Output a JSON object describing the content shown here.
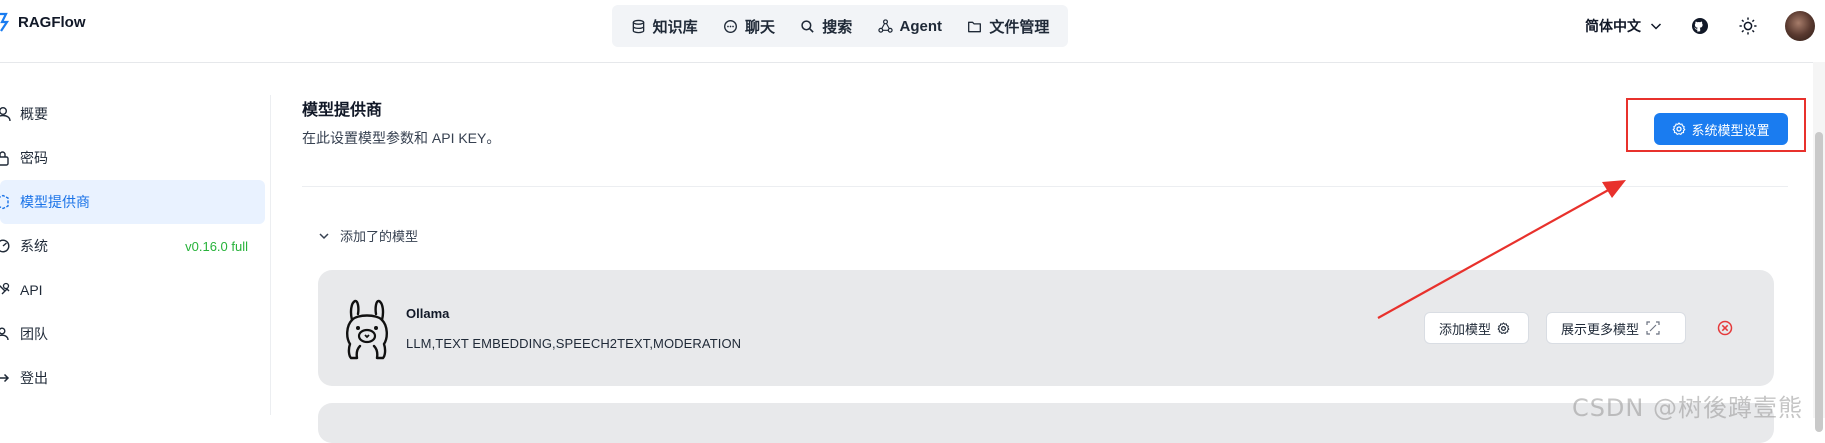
{
  "header": {
    "brand": "RAGFlow",
    "nav": [
      {
        "label": "知识库",
        "icon": "database-icon"
      },
      {
        "label": "聊天",
        "icon": "chat-bubble-icon"
      },
      {
        "label": "搜索",
        "icon": "search-icon"
      },
      {
        "label": "Agent",
        "icon": "agent-graph-icon"
      },
      {
        "label": "文件管理",
        "icon": "folder-icon"
      }
    ],
    "language": "简体中文",
    "tools": [
      "github-icon",
      "sun-icon",
      "avatar"
    ]
  },
  "sidebar": {
    "items": [
      {
        "label": "概要",
        "icon": "user-icon",
        "active": false
      },
      {
        "label": "密码",
        "icon": "lock-icon",
        "active": false
      },
      {
        "label": "模型提供商",
        "icon": "box-icon",
        "active": true
      },
      {
        "label": "系统",
        "icon": "gauge-icon",
        "active": false,
        "badge": "v0.16.0 full"
      },
      {
        "label": "API",
        "icon": "api-icon",
        "active": false
      },
      {
        "label": "团队",
        "icon": "team-icon",
        "active": false
      },
      {
        "label": "登出",
        "icon": "logout-icon",
        "active": false
      }
    ]
  },
  "main": {
    "title": "模型提供商",
    "subtitle": "在此设置模型参数和 API KEY。",
    "system_settings_button": "系统模型设置",
    "added_section_label": "添加了的模型",
    "providers": [
      {
        "name": "Ollama",
        "tags": "LLM,TEXT EMBEDDING,SPEECH2TEXT,MODERATION",
        "add_button": "添加模型",
        "more_button": "展示更多模型"
      }
    ]
  },
  "watermark": "CSDN @树後蹲壹熊",
  "colors": {
    "accent": "#1a7cf0",
    "active_bg": "#e9f2ff",
    "version_green": "#27b23a",
    "annotation_red": "#e8312c",
    "card_bg": "#e8e9eb"
  }
}
